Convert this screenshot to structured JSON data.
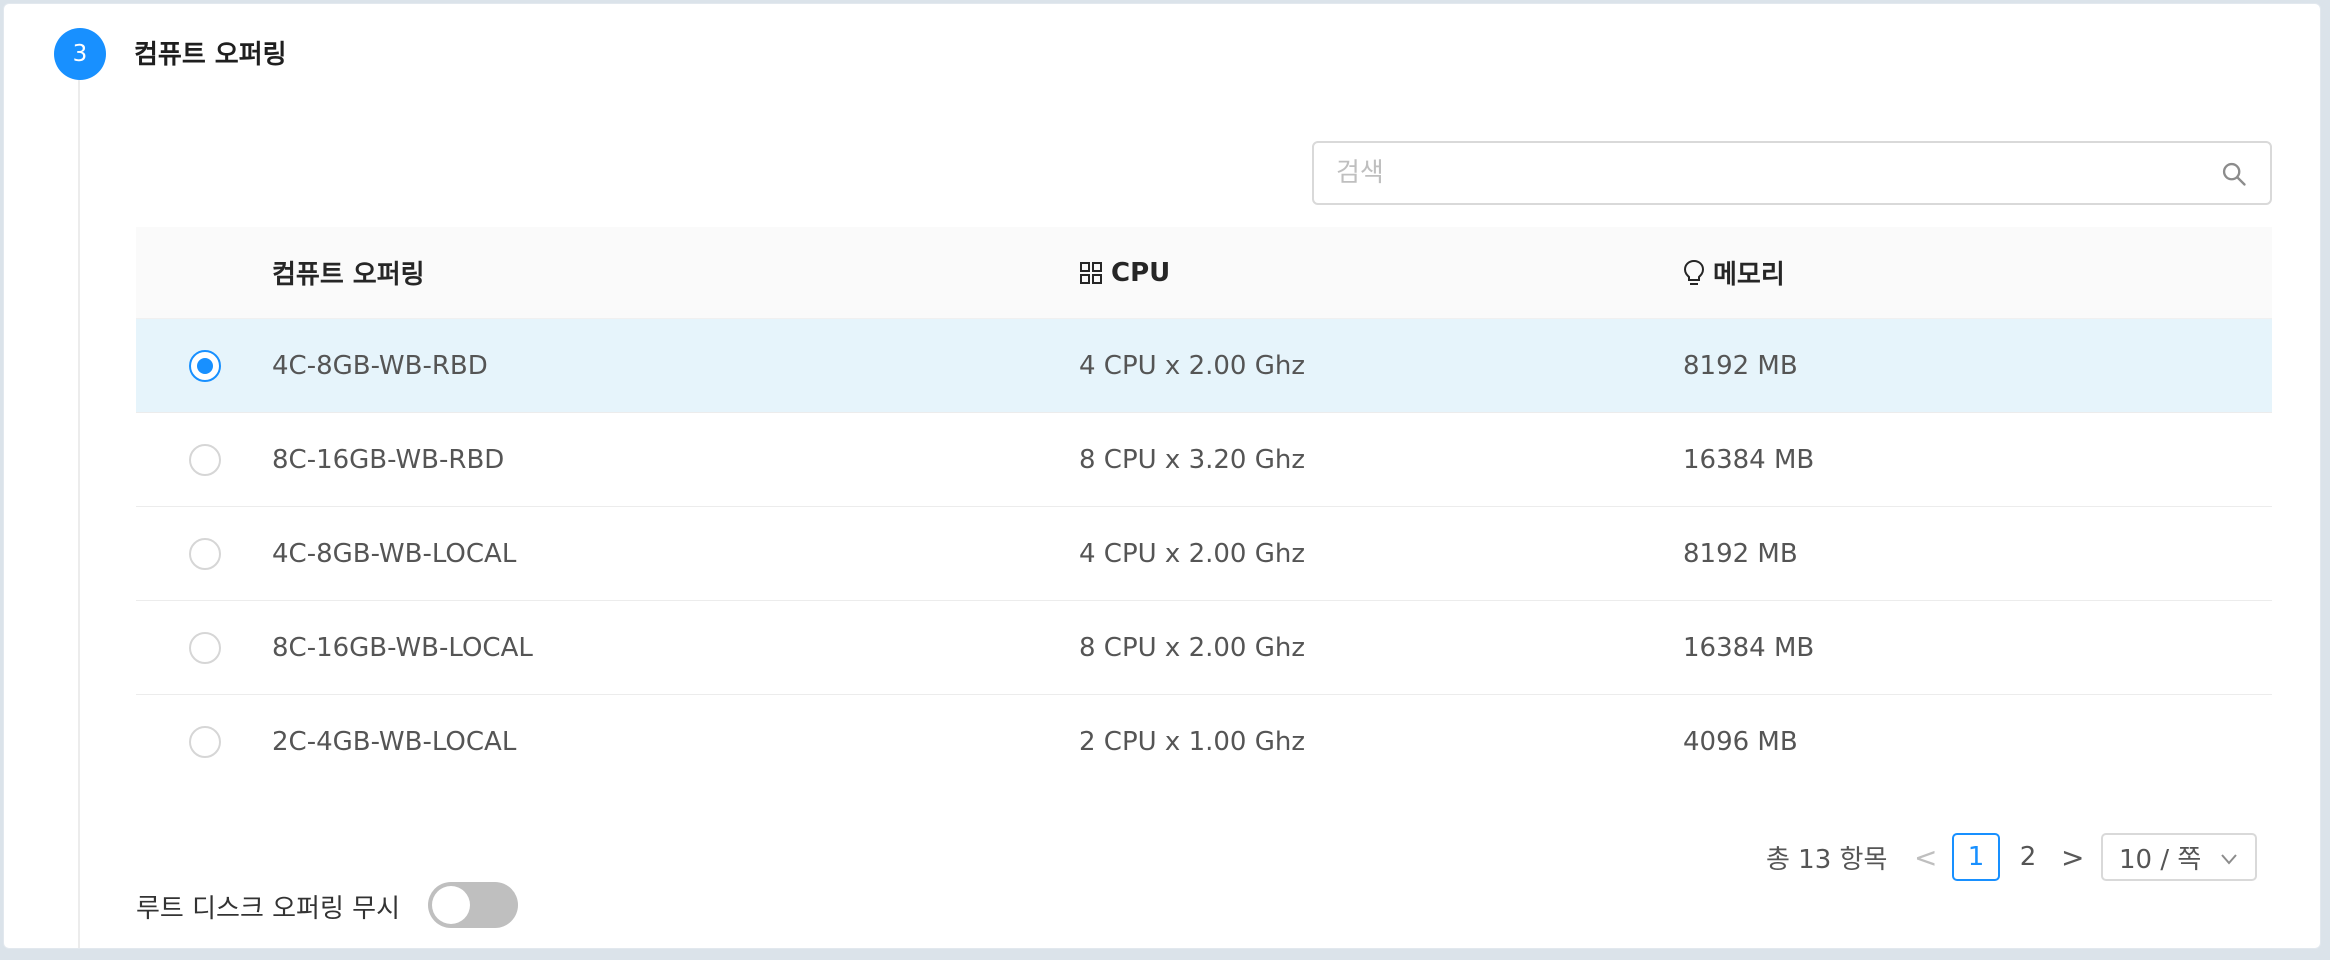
{
  "step": {
    "number": "3",
    "title": "컴퓨트 오퍼링"
  },
  "search": {
    "placeholder": "검색",
    "value": ""
  },
  "table": {
    "headers": {
      "name": "컴퓨트 오퍼링",
      "cpu": "CPU",
      "memory": "메모리"
    },
    "rows": [
      {
        "name": "4C-8GB-WB-RBD",
        "cpu": "4 CPU x 2.00 Ghz",
        "memory": "8192 MB",
        "selected": true
      },
      {
        "name": "8C-16GB-WB-RBD",
        "cpu": "8 CPU x 3.20 Ghz",
        "memory": "16384 MB",
        "selected": false
      },
      {
        "name": "4C-8GB-WB-LOCAL",
        "cpu": "4 CPU x 2.00 Ghz",
        "memory": "8192 MB",
        "selected": false
      },
      {
        "name": "8C-16GB-WB-LOCAL",
        "cpu": "8 CPU x 2.00 Ghz",
        "memory": "16384 MB",
        "selected": false
      },
      {
        "name": "2C-4GB-WB-LOCAL",
        "cpu": "2 CPU x 1.00 Ghz",
        "memory": "4096 MB",
        "selected": false
      }
    ]
  },
  "pagination": {
    "total_text": "총 13 항목",
    "pages": [
      "1",
      "2"
    ],
    "current_page": "1",
    "prev": "<",
    "next": ">",
    "page_size": "10 / 쪽"
  },
  "root_disk": {
    "label": "루트 디스크 오퍼링 무시",
    "enabled": false
  },
  "colors": {
    "accent": "#1890ff",
    "selected_row": "#e6f4fb"
  },
  "icons": {
    "search": "search-icon",
    "cpu": "grid-icon",
    "memory": "bulb-icon",
    "page_size": "chevron-down-icon"
  }
}
